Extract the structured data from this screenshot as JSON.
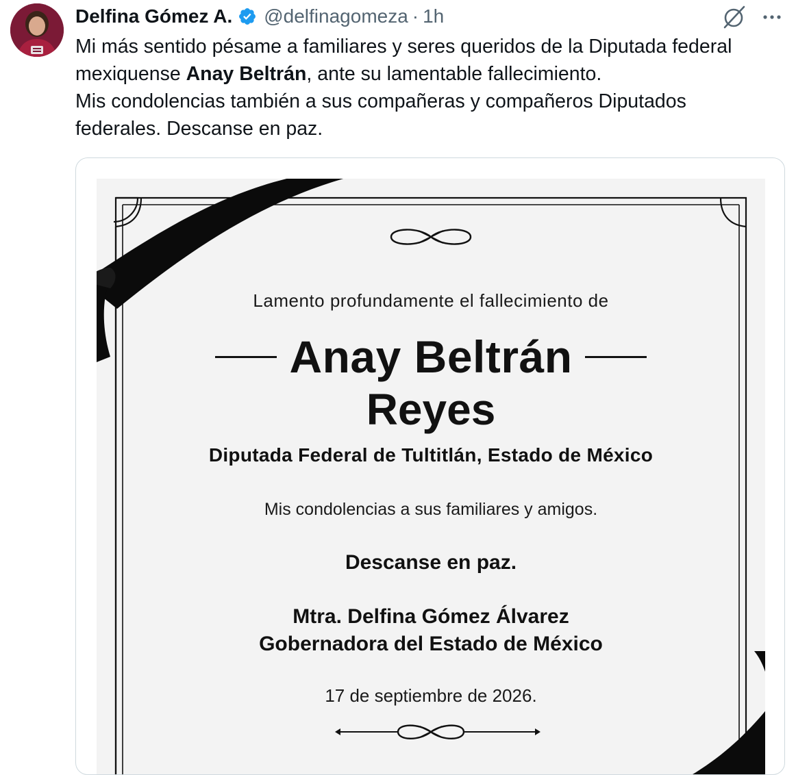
{
  "tweet": {
    "display_name": "Delfina Gómez A.",
    "handle": "@delfinagomeza",
    "separator": "·",
    "time": "1h",
    "text_line1": "Mi más sentido pésame a familiares y seres queridos de la Diputada federal",
    "text_line2_pre": "mexiquense ",
    "text_line2_bold": "Anay Beltrán",
    "text_line2_post": ", ante su lamentable fallecimiento.",
    "text_line3": "Mis condolencias también a sus compañeras y compañeros Diputados",
    "text_line4": "federales. Descanse en paz.",
    "icons": {
      "verified": "verified-badge-icon",
      "grok": "grok-icon",
      "more": "more-options-icon"
    },
    "colors": {
      "verified": "#1d9bf0",
      "secondary_text": "#536471"
    }
  },
  "card": {
    "intro": "Lamento profundamente el fallecimiento de",
    "name_first": "Anay Beltrán",
    "name_last": "Reyes",
    "position": "Diputada Federal de Tultitlán, Estado de México",
    "condolences": "Mis condolencias a sus familiares y amigos.",
    "rest": "Descanse en paz.",
    "signer": "Mtra. Delfina Gómez Álvarez",
    "signer_role": "Gobernadora del Estado de México",
    "date": "17 de septiembre de 2026."
  }
}
